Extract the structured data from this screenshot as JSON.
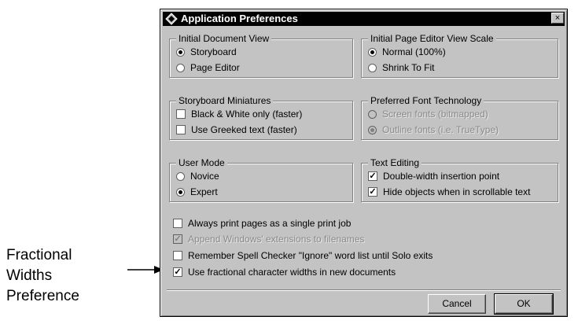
{
  "callout": {
    "lines": [
      "Fractional",
      "Widths",
      "Preference"
    ]
  },
  "dialog": {
    "title": "Application Preferences",
    "close_glyph": "×",
    "groups": {
      "initial_view": {
        "legend": "Initial Document View",
        "options": [
          {
            "label": "Storyboard",
            "selected": true
          },
          {
            "label": "Page Editor",
            "selected": false
          }
        ]
      },
      "view_scale": {
        "legend": "Initial Page Editor View Scale",
        "options": [
          {
            "label": "Normal (100%)",
            "selected": true
          },
          {
            "label": "Shrink To Fit",
            "selected": false
          }
        ]
      },
      "miniatures": {
        "legend": "Storyboard Miniatures",
        "options": [
          {
            "label": "Black & White only (faster)",
            "checked": false
          },
          {
            "label": "Use Greeked text (faster)",
            "checked": false
          }
        ]
      },
      "font_tech": {
        "legend": "Preferred Font Technology",
        "options": [
          {
            "label": "Screen fonts (bitmapped)",
            "selected": false,
            "disabled": true
          },
          {
            "label": "Outline fonts (i.e. TrueType)",
            "selected": true,
            "disabled": true
          }
        ]
      },
      "user_mode": {
        "legend": "User Mode",
        "options": [
          {
            "label": "Novice",
            "selected": false
          },
          {
            "label": "Expert",
            "selected": true
          }
        ]
      },
      "text_editing": {
        "legend": "Text Editing",
        "options": [
          {
            "label": "Double-width insertion point",
            "checked": true
          },
          {
            "label": "Hide objects when in scrollable text",
            "checked": true
          }
        ]
      }
    },
    "checkboxes": [
      {
        "label": "Always print pages as a single print job",
        "checked": false,
        "disabled": false
      },
      {
        "label": "Append Windows' extensions to filenames",
        "checked": true,
        "disabled": true
      },
      {
        "label": "Remember Spell Checker \"Ignore\" word list until Solo exits",
        "checked": false,
        "disabled": false
      },
      {
        "label": "Use fractional character widths in new documents",
        "checked": true,
        "disabled": false
      }
    ],
    "buttons": {
      "cancel": "Cancel",
      "ok": "OK"
    },
    "check_mark": "✓"
  }
}
